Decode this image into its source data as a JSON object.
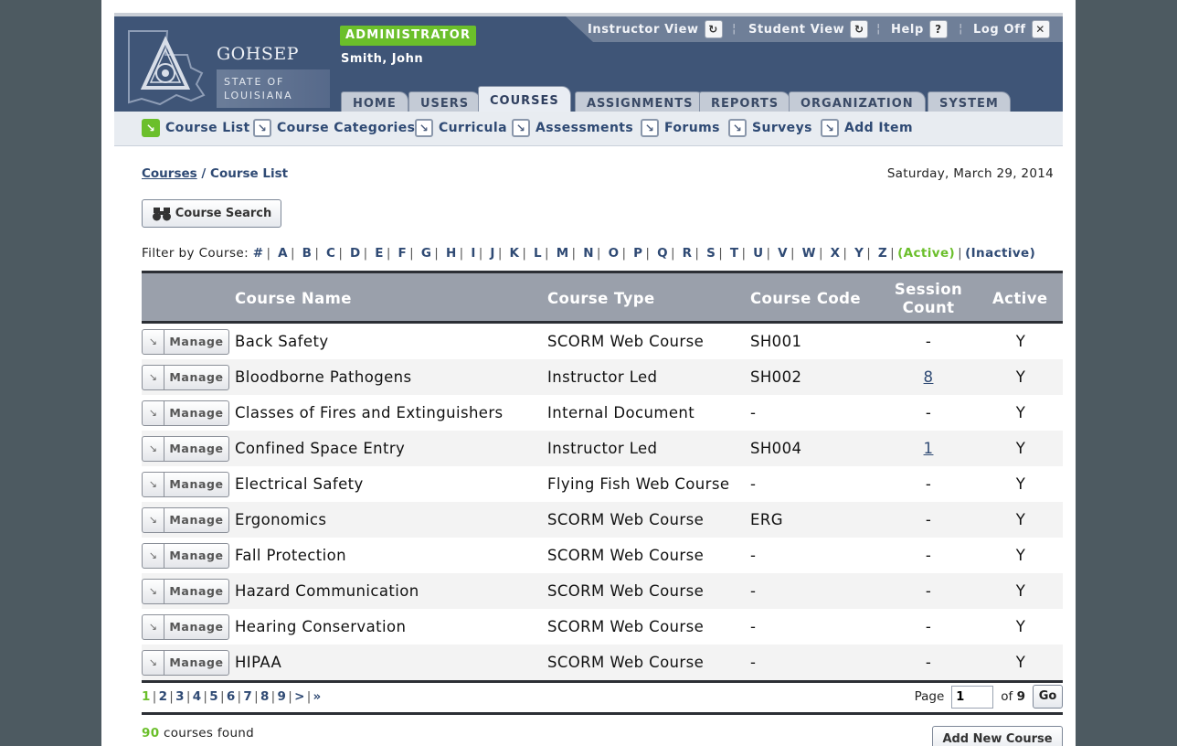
{
  "brand": {
    "org_name": "GOHSEP",
    "state_line1": "STATE OF",
    "state_line2": "LOUISIANA"
  },
  "user": {
    "role": "ADMINISTRATOR",
    "name": "Smith, John"
  },
  "toplinks": [
    {
      "label": "Instructor View",
      "icon": "↻"
    },
    {
      "label": "Student View",
      "icon": "↻"
    },
    {
      "label": "Help",
      "icon": "?"
    },
    {
      "label": "Log Off",
      "icon": "✕"
    }
  ],
  "tabs": [
    "HOME",
    "USERS",
    "COURSES",
    "ASSIGNMENTS",
    "REPORTS",
    "ORGANIZATION",
    "SYSTEM"
  ],
  "active_tab": "COURSES",
  "subnav": [
    "Course List",
    "Course Categories",
    "Curricula",
    "Assessments",
    "Forums",
    "Surveys",
    "Add Item"
  ],
  "breadcrumb": {
    "root": "Courses",
    "sep": "/",
    "current": "Course List"
  },
  "date": "Saturday, March 29, 2014",
  "search_label": "Course Search",
  "filter": {
    "label": "Filter by Course:",
    "letters": [
      "#",
      "A",
      "B",
      "C",
      "D",
      "E",
      "F",
      "G",
      "H",
      "I",
      "J",
      "K",
      "L",
      "M",
      "N",
      "O",
      "P",
      "Q",
      "R",
      "S",
      "T",
      "U",
      "V",
      "W",
      "X",
      "Y",
      "Z"
    ],
    "active": "(Active)",
    "inactive": "(Inactive)"
  },
  "table": {
    "headers": {
      "name": "Course Name",
      "type": "Course Type",
      "code": "Course Code",
      "session": "Session Count",
      "active": "Active"
    },
    "manage_label": "Manage",
    "rows": [
      {
        "name": "Back Safety",
        "type": "SCORM Web Course",
        "code": "SH001",
        "session": "-",
        "active": "Y"
      },
      {
        "name": "Bloodborne Pathogens",
        "type": "Instructor Led",
        "code": "SH002",
        "session": "8",
        "active": "Y"
      },
      {
        "name": "Classes of Fires and Extinguishers",
        "type": "Internal Document",
        "code": "-",
        "session": "-",
        "active": "Y"
      },
      {
        "name": "Confined Space Entry",
        "type": "Instructor Led",
        "code": "SH004",
        "session": "1",
        "active": "Y"
      },
      {
        "name": "Electrical Safety",
        "type": "Flying Fish Web Course",
        "code": "-",
        "session": "-",
        "active": "Y"
      },
      {
        "name": "Ergonomics",
        "type": "SCORM Web Course",
        "code": "ERG",
        "session": "-",
        "active": "Y"
      },
      {
        "name": "Fall Protection",
        "type": "SCORM Web Course",
        "code": "-",
        "session": "-",
        "active": "Y"
      },
      {
        "name": "Hazard Communication",
        "type": "SCORM Web Course",
        "code": "-",
        "session": "-",
        "active": "Y"
      },
      {
        "name": "Hearing Conservation",
        "type": "SCORM Web Course",
        "code": "-",
        "session": "-",
        "active": "Y"
      },
      {
        "name": "HIPAA",
        "type": "SCORM Web Course",
        "code": "-",
        "session": "-",
        "active": "Y"
      }
    ]
  },
  "pager": {
    "pages": [
      "1",
      "2",
      "3",
      "4",
      "5",
      "6",
      "7",
      "8",
      "9",
      ">",
      "»"
    ],
    "current": "1",
    "page_label": "Page",
    "page_value": "1",
    "of_label": "of",
    "total_pages": "9",
    "go_label": "Go"
  },
  "footer": {
    "count": "90",
    "count_label": "courses found",
    "add_label": "Add New Course"
  },
  "colors": {
    "header_bg": "#3f5577",
    "accent_green": "#6bbf2b",
    "link_blue": "#2f4a74",
    "table_header": "#9aa0ab"
  }
}
